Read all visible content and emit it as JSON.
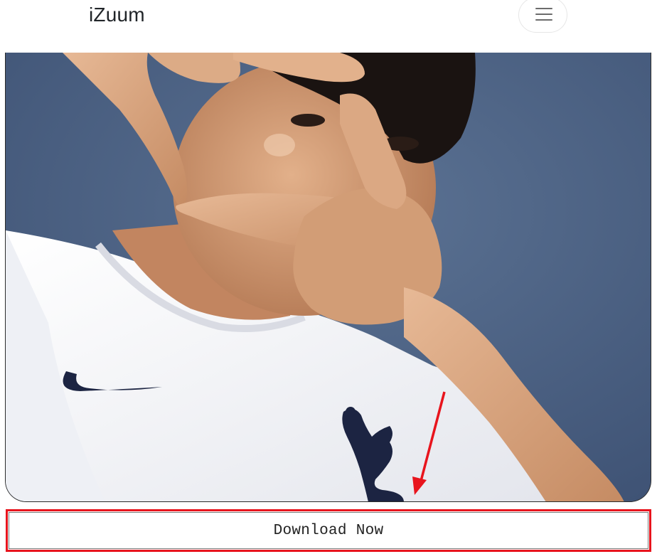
{
  "header": {
    "brand": "iZuum",
    "menu_icon": "hamburger-menu-icon"
  },
  "image": {
    "subject": "photo",
    "icons": [
      "nike-swoosh-logo",
      "club-crest-logo",
      "red-arrow-annotation"
    ]
  },
  "download": {
    "label": "Download Now",
    "highlight_color": "#e8141d"
  },
  "colors": {
    "background_blue": "#4f6586",
    "shirt": "#f1f2f6",
    "navy": "#1c2442",
    "skin": "#d8a57e",
    "hair": "#1a1311",
    "annotation_red": "#e8141d"
  }
}
